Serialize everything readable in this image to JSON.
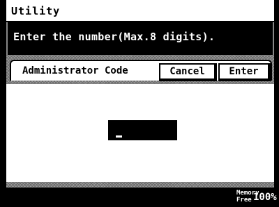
{
  "window": {
    "title": "Utility"
  },
  "message": "Enter the number(Max.8 digits).",
  "form": {
    "label": "Administrator Code",
    "cancel_label": "Cancel",
    "enter_label": "Enter",
    "input_value": ""
  },
  "status": {
    "memory_label_line1": "Memory",
    "memory_label_line2": "Free",
    "memory_value": "100%"
  },
  "colors": {
    "background": "#ffffff",
    "ink": "#000000",
    "stripe": "#9a9a9a"
  }
}
